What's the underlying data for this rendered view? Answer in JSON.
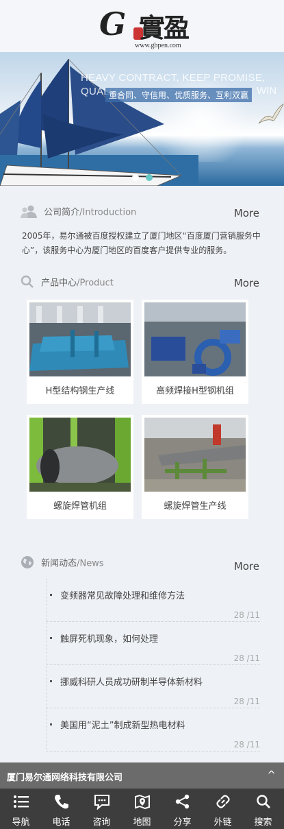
{
  "header": {
    "logo_letter": "G",
    "logo_cn": "實盈",
    "logo_url": "www.gbpen.com"
  },
  "banner": {
    "english_slogan": "HEAVY CONTRACT, KEEP PROMISE, QUALITY SERVICE",
    "english_slogan_end": "WIN",
    "chinese_slogan": "重合同、守信用、优质服务、互利双赢"
  },
  "intro": {
    "title": "公司简介",
    "title_en": "/Introduction",
    "more": "More",
    "text": "2005年，易尔通被百度授权建立了厦门地区“百度厦门营销服务中心”，该服务中心为厦门地区的百度客户提供专业的服务。"
  },
  "products": {
    "title": "产品中心",
    "title_en": "/Product",
    "more": "More",
    "items": [
      {
        "caption": "H型结构钢生产线"
      },
      {
        "caption": "高频焊接H型钢机组"
      },
      {
        "caption": "螺旋焊管机组"
      },
      {
        "caption": "螺旋焊管生产线"
      }
    ]
  },
  "news": {
    "title": "新闻动态",
    "title_en": "/News",
    "more": "More",
    "items": [
      {
        "title": "变频器常见故障处理和维修方法",
        "date": "28 /11"
      },
      {
        "title": "触屏死机现象，如何处理",
        "date": "28 /11"
      },
      {
        "title": "挪威科研人员成功研制半导体新材料",
        "date": "28 /11"
      },
      {
        "title": "美国用“泥土”制成新型热电材料",
        "date": "28 /11"
      }
    ]
  },
  "footer": {
    "company": "厦门易尔通网络科技有限公司",
    "up": "^"
  },
  "nav": [
    {
      "label": "导航",
      "icon": "menu-icon"
    },
    {
      "label": "电话",
      "icon": "phone-icon"
    },
    {
      "label": "咨询",
      "icon": "chat-icon"
    },
    {
      "label": "地图",
      "icon": "map-icon"
    },
    {
      "label": "分享",
      "icon": "share-icon"
    },
    {
      "label": "外链",
      "icon": "link-icon"
    },
    {
      "label": "搜索",
      "icon": "search-icon"
    }
  ]
}
